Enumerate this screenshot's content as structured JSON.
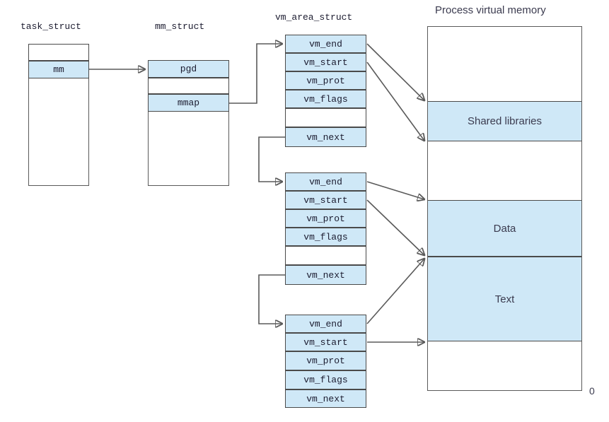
{
  "diagram": {
    "title_labels": {
      "task_struct": "task_struct",
      "mm_struct": "mm_struct",
      "vm_area_struct": "vm_area_struct",
      "process_virtual_memory": "Process virtual memory"
    },
    "colors": {
      "highlight_fill": "#cfe8f7",
      "stroke": "#5a5a5a",
      "text": "#1b1b2f",
      "sans_text": "#3b3b4f",
      "background": "#ffffff"
    },
    "task_struct": {
      "name": "task_struct",
      "fields": [
        {
          "label": "",
          "highlighted": false
        },
        {
          "label": "mm",
          "highlighted": true
        }
      ]
    },
    "mm_struct": {
      "name": "mm_struct",
      "fields": [
        {
          "label": "pgd",
          "highlighted": true
        },
        {
          "label": "",
          "highlighted": false
        },
        {
          "label": "mmap",
          "highlighted": true
        }
      ]
    },
    "vm_area_structs": [
      {
        "index": 1,
        "fields": [
          {
            "label": "vm_end",
            "highlighted": true
          },
          {
            "label": "vm_start",
            "highlighted": true
          },
          {
            "label": "vm_prot",
            "highlighted": true
          },
          {
            "label": "vm_flags",
            "highlighted": true
          },
          {
            "label": "",
            "highlighted": false
          },
          {
            "label": "vm_next",
            "highlighted": true
          }
        ]
      },
      {
        "index": 2,
        "fields": [
          {
            "label": "vm_end",
            "highlighted": true
          },
          {
            "label": "vm_start",
            "highlighted": true
          },
          {
            "label": "vm_prot",
            "highlighted": true
          },
          {
            "label": "vm_flags",
            "highlighted": true
          },
          {
            "label": "",
            "highlighted": false
          },
          {
            "label": "vm_next",
            "highlighted": true
          }
        ]
      },
      {
        "index": 3,
        "fields": [
          {
            "label": "vm_end",
            "highlighted": true
          },
          {
            "label": "vm_start",
            "highlighted": true
          },
          {
            "label": "vm_prot",
            "highlighted": true
          },
          {
            "label": "vm_flags",
            "highlighted": true
          },
          {
            "label": "vm_next",
            "highlighted": true
          }
        ]
      }
    ],
    "process_virtual_memory": {
      "title": "Process virtual memory",
      "bottom_address_label": "0",
      "segments": [
        {
          "label": "",
          "highlighted": false
        },
        {
          "label": "Shared libraries",
          "highlighted": true
        },
        {
          "label": "",
          "highlighted": false
        },
        {
          "label": "Data",
          "highlighted": true
        },
        {
          "label": "Text",
          "highlighted": true
        },
        {
          "label": "",
          "highlighted": false
        }
      ]
    }
  }
}
